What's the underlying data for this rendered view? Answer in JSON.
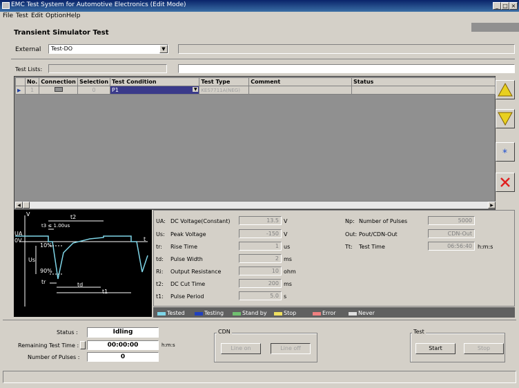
{
  "window": {
    "title": "EMC Test System for Automotive Electronics (Edit Mode)",
    "controls": [
      "_",
      "□",
      "×"
    ]
  },
  "menu": [
    "File",
    "Test",
    "Edit",
    "Option",
    "Help"
  ],
  "page": {
    "title": "Transient Simulator Test"
  },
  "external": {
    "label": "External",
    "value": "Test-DO"
  },
  "test_lists": {
    "label": "Test Lists:"
  },
  "grid": {
    "headers": [
      "No.",
      "Connection",
      "Selection",
      "Test Condition",
      "Test Type",
      "Comment",
      "Status"
    ],
    "row": {
      "no": "1",
      "selection": "0",
      "condition": "P1",
      "type": "KES7711A(NEG)"
    }
  },
  "diagram": {
    "labels": {
      "v": "V",
      "t2": "t2",
      "t3": "t3 ≤ 1.00us",
      "ua": "UA",
      "ov": "0V",
      "t": "t",
      "p10": "10%",
      "us": "Us",
      "p90": "90%",
      "tr": "tr",
      "td": "td",
      "t1": "t1"
    }
  },
  "params_left": [
    {
      "sym": "UA:",
      "name": "DC Voltage(Constant)",
      "value": "13.5",
      "unit": "V"
    },
    {
      "sym": "Us:",
      "name": "Peak Voltage",
      "value": "-150",
      "unit": "V"
    },
    {
      "sym": "tr:",
      "name": "Rise Time",
      "value": "1",
      "unit": "us"
    },
    {
      "sym": "td:",
      "name": "Pulse Width",
      "value": "2",
      "unit": "ms"
    },
    {
      "sym": "Ri:",
      "name": "Output Resistance",
      "value": "10",
      "unit": "ohm"
    },
    {
      "sym": "t2:",
      "name": "DC Cut Time",
      "value": "200",
      "unit": "ms"
    },
    {
      "sym": "t1:",
      "name": "Pulse Period",
      "value": "5.0",
      "unit": "s"
    }
  ],
  "params_right": [
    {
      "sym": "Np:",
      "name": "Number of Pulses",
      "value": "5000",
      "unit": ""
    },
    {
      "sym": "Out:",
      "name": "Pout/CDN-Out",
      "value": "CDN-Out",
      "unit": ""
    },
    {
      "sym": "Tt:",
      "name": "Test Time",
      "value": "06:56:40",
      "unit": "h:m:s"
    }
  ],
  "legend": [
    {
      "label": "Tested",
      "color": "#7fd6e8"
    },
    {
      "label": "Testing",
      "color": "#2040c0"
    },
    {
      "label": "Stand by",
      "color": "#70c070"
    },
    {
      "label": "Stop",
      "color": "#f0e060"
    },
    {
      "label": "Error",
      "color": "#f08080"
    },
    {
      "label": "Never",
      "color": "#e0e0e0"
    }
  ],
  "status": {
    "status_label": "Status :",
    "status_value": "Idling",
    "remaining_label": "Remaining Test Time :",
    "remaining_value": "00:00:00",
    "remaining_unit": "h:m:s",
    "pulses_label": "Number of Pulses :",
    "pulses_value": "0"
  },
  "cdn": {
    "title": "CDN",
    "line_on": "Line on",
    "line_off": "Line off"
  },
  "test": {
    "title": "Test",
    "start": "Start",
    "stop": "Stop"
  },
  "colors": {
    "titlebar": "#0a246a",
    "diagram_bg": "#000000",
    "selected_row": "#3a3a8a"
  }
}
